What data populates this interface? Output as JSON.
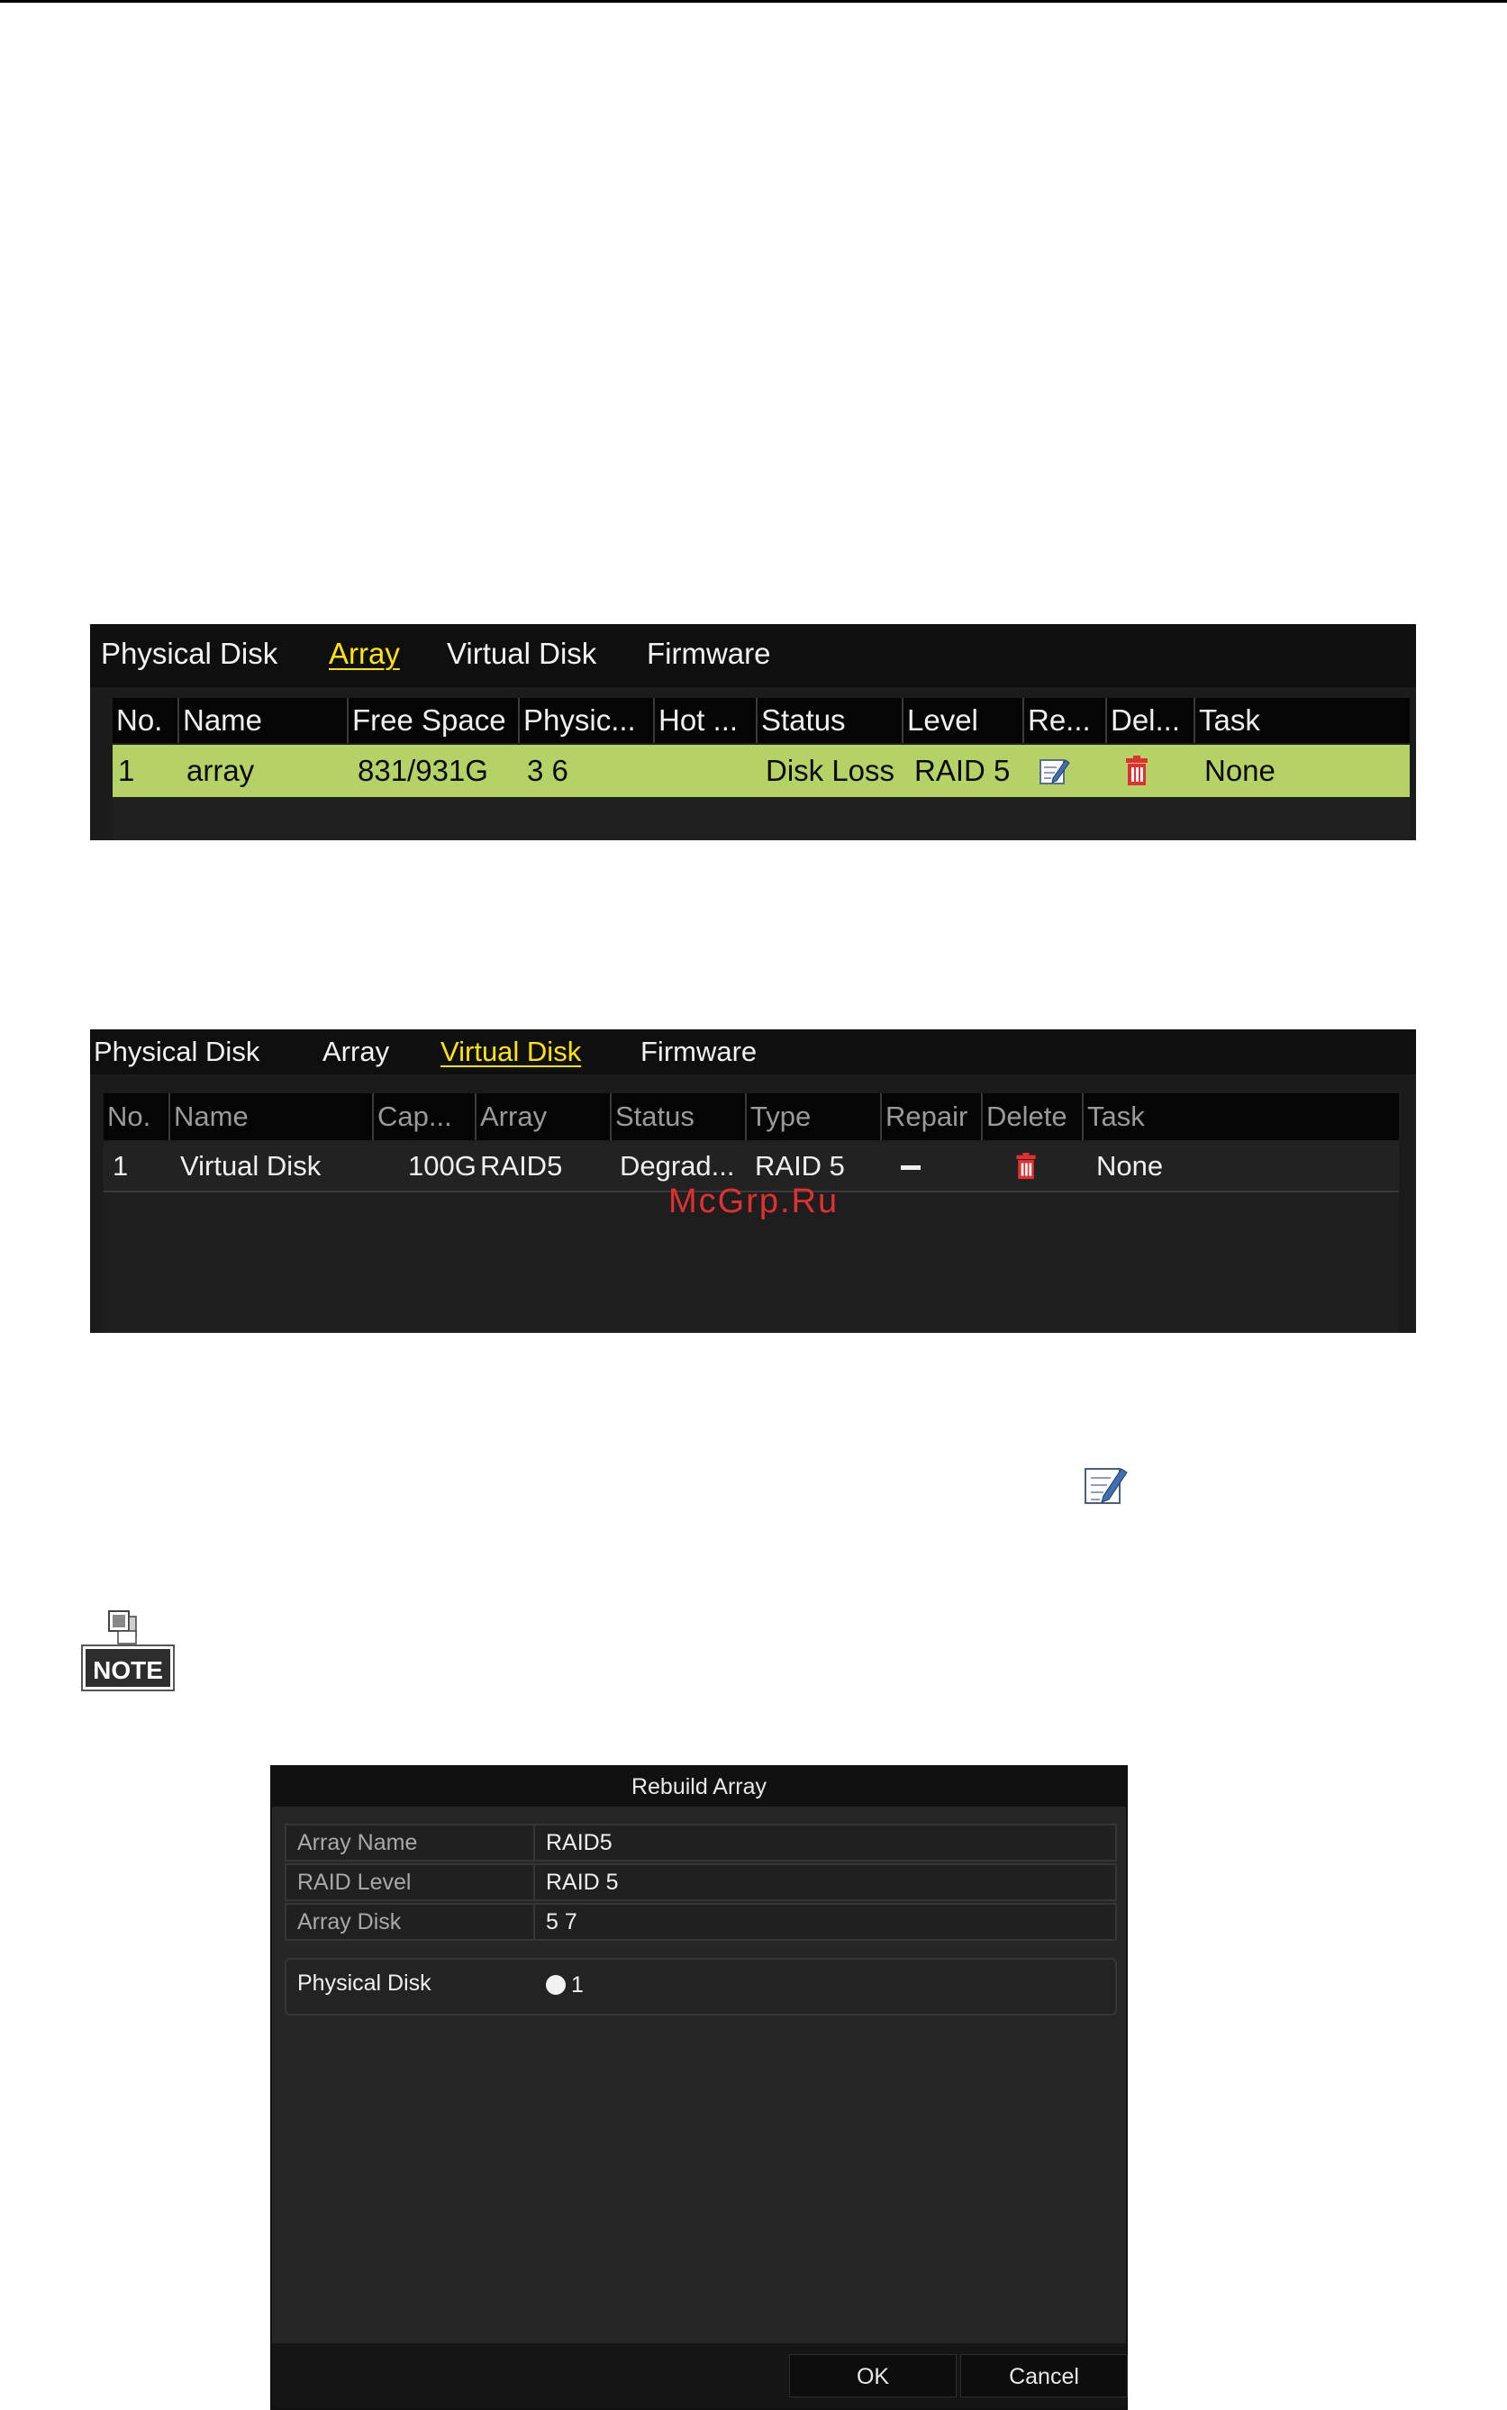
{
  "array_panel": {
    "tabs": [
      {
        "label": "Physical Disk"
      },
      {
        "label": "Array",
        "active": true
      },
      {
        "label": "Virtual Disk"
      },
      {
        "label": "Firmware"
      }
    ],
    "columns": [
      "No.",
      "Name",
      "Free Space",
      "Physic...",
      "Hot ...",
      "Status",
      "Level",
      "Re...",
      "Del...",
      "Task"
    ],
    "row": {
      "no": "1",
      "name": "array",
      "free_space": "831/931G",
      "physical": "3  6",
      "hot": "",
      "status": "Disk Loss",
      "level": "RAID 5",
      "rebuild_icon": "edit-icon",
      "delete_icon": "trash-icon",
      "task": "None"
    },
    "selected_color": "#b5d267"
  },
  "virtual_panel": {
    "tabs": [
      {
        "label": "Physical Disk"
      },
      {
        "label": "Array"
      },
      {
        "label": "Virtual Disk",
        "active": true
      },
      {
        "label": "Firmware"
      }
    ],
    "columns": [
      "No.",
      "Name",
      "Cap...",
      "Array",
      "Status",
      "Type",
      "Repair",
      "Delete",
      "Task"
    ],
    "row": {
      "no": "1",
      "name": "Virtual Disk",
      "capacity": "100G",
      "array": "RAID5",
      "status": "Degrad...",
      "type": "RAID 5",
      "repair_icon": "dash-icon",
      "delete_icon": "trash-icon",
      "task": "None"
    }
  },
  "watermark": "McGrp.Ru",
  "note_icon": {
    "label": "NOTE"
  },
  "rebuild_dialog": {
    "title": "Rebuild Array",
    "fields": [
      {
        "label": "Array Name",
        "value": "RAID5"
      },
      {
        "label": "RAID Level",
        "value": "RAID 5"
      },
      {
        "label": "Array Disk",
        "value": "5  7"
      }
    ],
    "physical_disk": {
      "label": "Physical Disk",
      "option": "1"
    },
    "buttons": {
      "ok": "OK",
      "cancel": "Cancel"
    }
  },
  "colors": {
    "active_tab": "#ffe600",
    "trash": "#e0302f",
    "panel_bg": "#1b1b1b"
  }
}
